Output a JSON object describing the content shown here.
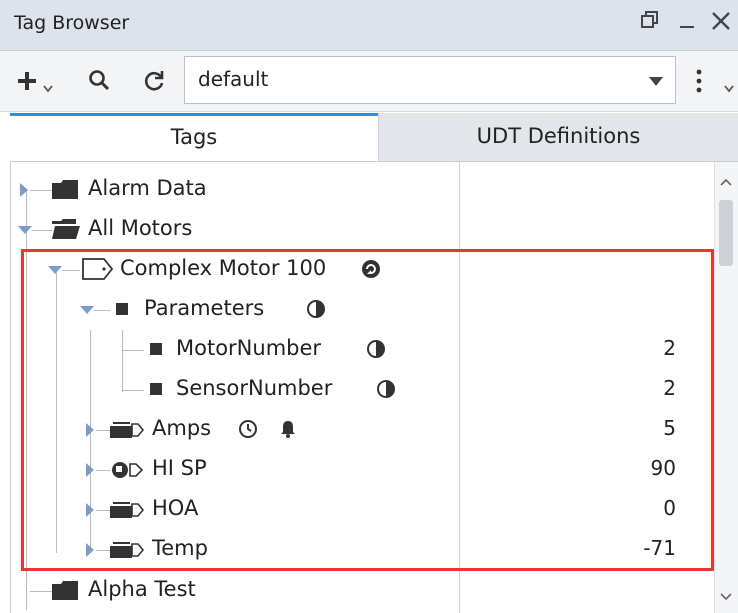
{
  "window": {
    "title": "Tag Browser",
    "restore_icon": "restore-window-icon",
    "minimize_icon": "minimize-icon",
    "close_icon": "close-icon"
  },
  "toolbar": {
    "add_icon": "plus-icon",
    "search_icon": "search-icon",
    "refresh_icon": "refresh-icon",
    "provider_value": "default",
    "menu_icon": "kebab-menu-icon"
  },
  "tabs": [
    {
      "label": "Tags",
      "active": true
    },
    {
      "label": "UDT Definitions",
      "active": false
    }
  ],
  "tree": {
    "alarm_data": {
      "label": "Alarm Data"
    },
    "all_motors": {
      "label": "All Motors"
    },
    "complex_motor": {
      "label": "Complex Motor 100"
    },
    "parameters": {
      "label": "Parameters"
    },
    "motor_number": {
      "label": "MotorNumber",
      "value": "2"
    },
    "sensor_number": {
      "label": "SensorNumber",
      "value": "2"
    },
    "amps": {
      "label": "Amps",
      "value": "5"
    },
    "hi_sp": {
      "label": "HI SP",
      "value": "90"
    },
    "hoa": {
      "label": "HOA",
      "value": "0"
    },
    "temp": {
      "label": "Temp",
      "value": "-71"
    },
    "alpha_test": {
      "label": "Alpha Test"
    }
  },
  "colors": {
    "accent_tab": "#2f8fd8",
    "highlight_box": "#e53935",
    "expander": "#7a9cc7"
  }
}
